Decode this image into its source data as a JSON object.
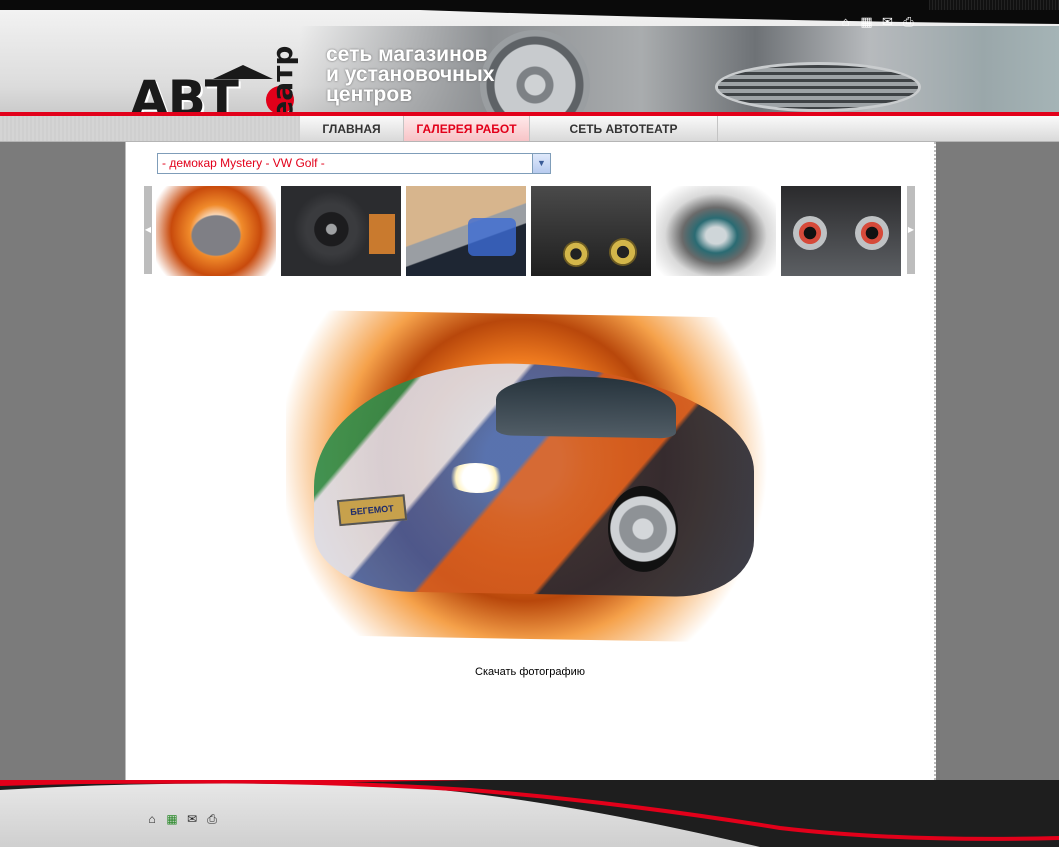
{
  "header": {
    "logo_text": "АВТОтеатр",
    "tagline_lines": [
      "сеть магазинов",
      "и установочных",
      "центров"
    ],
    "icons": [
      "home-icon",
      "sitemap-icon",
      "mail-icon",
      "print-icon"
    ]
  },
  "nav": {
    "items": [
      {
        "label": "ГЛАВНАЯ",
        "active": false
      },
      {
        "label": "ГАЛЕРЕЯ РАБОТ",
        "active": true
      },
      {
        "label": "СЕТЬ АВТОТЕАТР",
        "active": false
      }
    ]
  },
  "gallery": {
    "selected_album": "- демокар Mystery - VW Golf -",
    "thumbnails": [
      "car-front",
      "steering-wheel",
      "dashboard-pillar",
      "door-speakers",
      "painted-hood",
      "trunk-amplifiers"
    ],
    "main_photo_plate": "БЕГЕМОТ",
    "download_label": "Скачать фотографию"
  },
  "footer": {
    "icons": [
      "home-icon",
      "sitemap-icon",
      "mail-icon",
      "print-icon"
    ]
  },
  "colors": {
    "accent_red": "#e2001a",
    "background_gray": "#7b7b7b",
    "content_bg": "#ffffff"
  }
}
